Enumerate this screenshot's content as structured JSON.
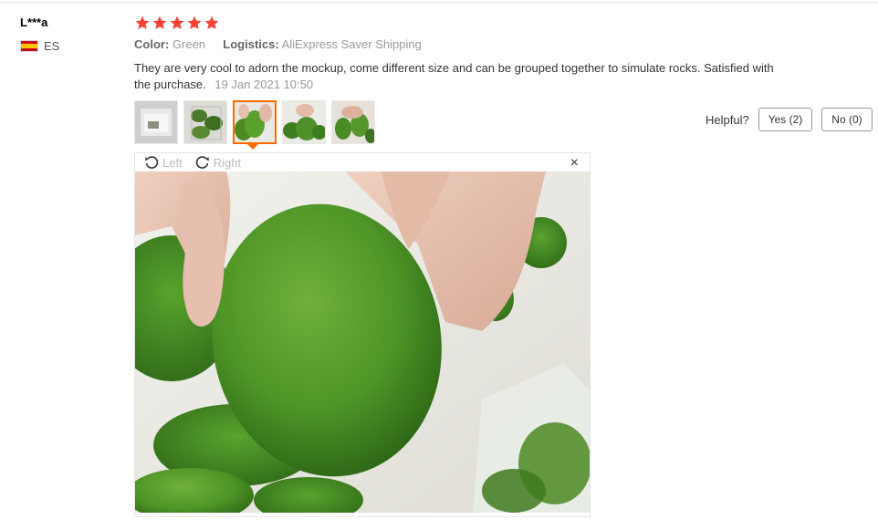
{
  "review": {
    "user": "L***a",
    "country": "ES",
    "rating_stars": 5,
    "color_label": "Color:",
    "color_value": "Green",
    "logistics_label": "Logistics:",
    "logistics_value": "AliExpress Saver Shipping",
    "text": "They are very cool to adorn the mockup, come different size and can be grouped together to simulate rocks. Satisfied with the purchase.",
    "date": "19 Jan 2021 10:50"
  },
  "helpful": {
    "label": "Helpful?",
    "yes": "Yes (2)",
    "no": "No (0)"
  },
  "viewer": {
    "rotate_left": "Left",
    "rotate_right": "Right",
    "close": "×"
  },
  "colors": {
    "star": "#f44336",
    "accent": "#ff6a00",
    "moss": "#4f8f25"
  }
}
